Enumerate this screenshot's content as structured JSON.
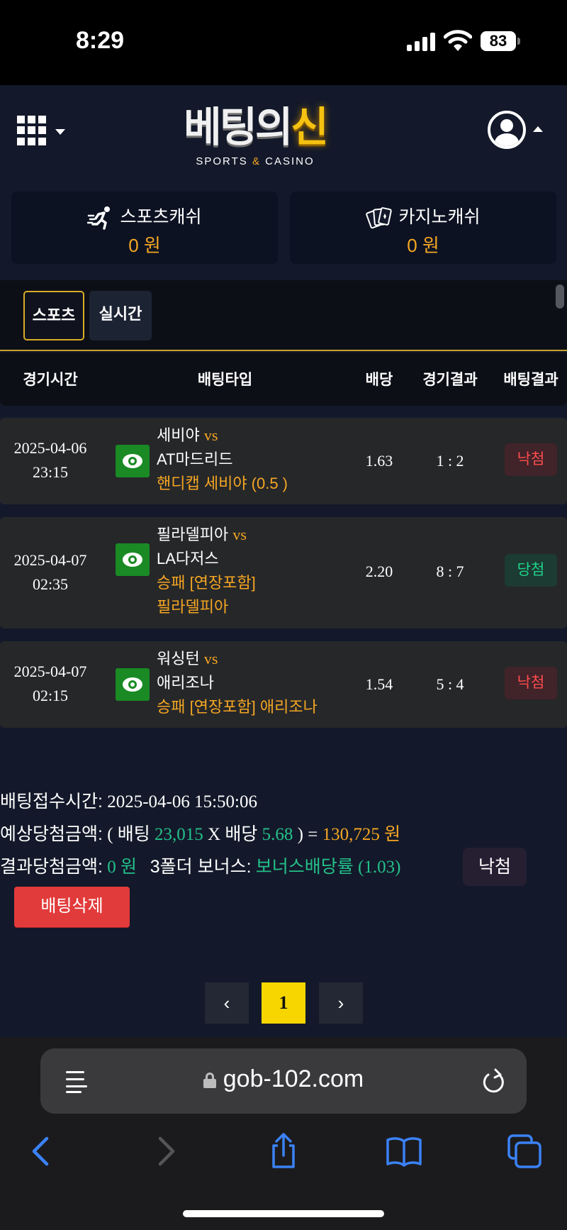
{
  "status_bar": {
    "time": "8:29",
    "battery": "83"
  },
  "brand": {
    "logo_main": "베팅의",
    "logo_accent": "신",
    "logo_sub_left": "SPORTS",
    "logo_sub_amp": "&",
    "logo_sub_right": "CASINO"
  },
  "wallet": {
    "sports": {
      "label": "스포츠캐쉬",
      "value": "0 원"
    },
    "casino": {
      "label": "카지노캐쉬",
      "value": "0 원"
    }
  },
  "tabs": [
    {
      "label": "스포츠",
      "active": true
    },
    {
      "label": "실시간",
      "active": false
    }
  ],
  "table": {
    "headers": [
      "경기시간",
      "배팅타입",
      "배당",
      "경기결과",
      "배팅결과"
    ],
    "rows": [
      {
        "date": "2025-04-06",
        "time": "23:15",
        "home": "세비야",
        "vs": "vs",
        "away": "AT마드리드",
        "pick_line1": "핸디캡 세비야 (0.5 )",
        "pick_line2": "",
        "odds": "1.63",
        "score": "1 : 2",
        "result": "낙첨",
        "result_type": "lose"
      },
      {
        "date": "2025-04-07",
        "time": "02:35",
        "home": "필라델피아",
        "vs": "vs",
        "away": "LA다저스",
        "pick_line1": "승패 [연장포함]",
        "pick_line2": "필라델피아",
        "odds": "2.20",
        "score": "8 : 7",
        "result": "당첨",
        "result_type": "win"
      },
      {
        "date": "2025-04-07",
        "time": "02:15",
        "home": "워싱턴",
        "vs": "vs",
        "away": "애리조나",
        "pick_line1": "승패 [연장포함] 애리조나",
        "pick_line2": "",
        "odds": "1.54",
        "score": "5 : 4",
        "result": "낙첨",
        "result_type": "lose"
      }
    ]
  },
  "summary": {
    "receipt_label": "배팅접수시간:",
    "receipt_time": "2025-04-06 15:50:06",
    "expected_label": "예상당첨금액:",
    "open_paren": "(",
    "bet_label": "배팅",
    "bet_amount": "23,015",
    "times": "X",
    "odds_label": "배당",
    "total_odds": "5.68",
    "close_eq": ") =",
    "expected_amount": "130,725 원",
    "result_label": "결과당첨금액:",
    "result_amount": "0 원",
    "bonus_label": "3폴더 보너스:",
    "bonus_value": "보너스배당률 (1.03)",
    "final_status": "낙첨",
    "delete_label": "배팅삭제"
  },
  "pagination": {
    "prev": "‹",
    "current": "1",
    "next": "›"
  },
  "browser": {
    "url": "gob-102.com"
  },
  "colors": {
    "accent_orange": "#f5a623",
    "win_green": "#1fd38c",
    "lose_red": "#ff4d4d",
    "eye_green": "#198a24",
    "delete_red": "#e23b3b",
    "page_yellow": "#f7d600"
  }
}
